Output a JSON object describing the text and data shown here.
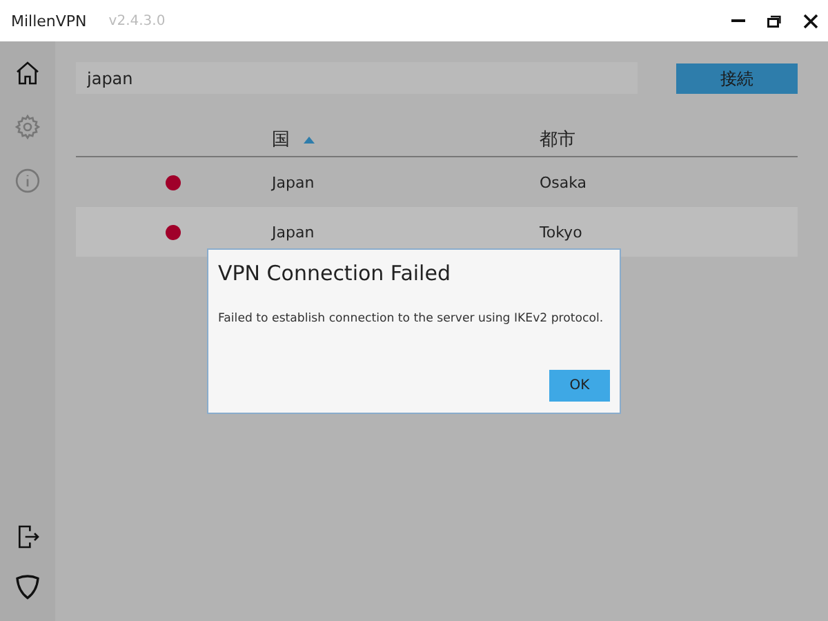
{
  "window": {
    "title": "MillenVPN",
    "version": "v2.4.3.0"
  },
  "sidebar": {
    "items": [
      {
        "kind": "home",
        "selected": true
      },
      {
        "kind": "settings",
        "selected": false
      },
      {
        "kind": "info",
        "selected": false
      }
    ],
    "bottom_items": [
      {
        "kind": "logout"
      },
      {
        "kind": "shield"
      }
    ]
  },
  "search": {
    "value": "japan"
  },
  "connect_button": "接続",
  "table": {
    "columns": [
      {
        "label": "国",
        "sorted": true
      },
      {
        "label": "都市",
        "sorted": false
      }
    ],
    "rows": [
      {
        "country": "Japan",
        "city": "Osaka"
      },
      {
        "country": "Japan",
        "city": "Tokyo"
      }
    ]
  },
  "dialog": {
    "title": "VPN Connection Failed",
    "message": "Failed to establish connection to the server using IKEv2 protocol.",
    "button": "OK"
  }
}
